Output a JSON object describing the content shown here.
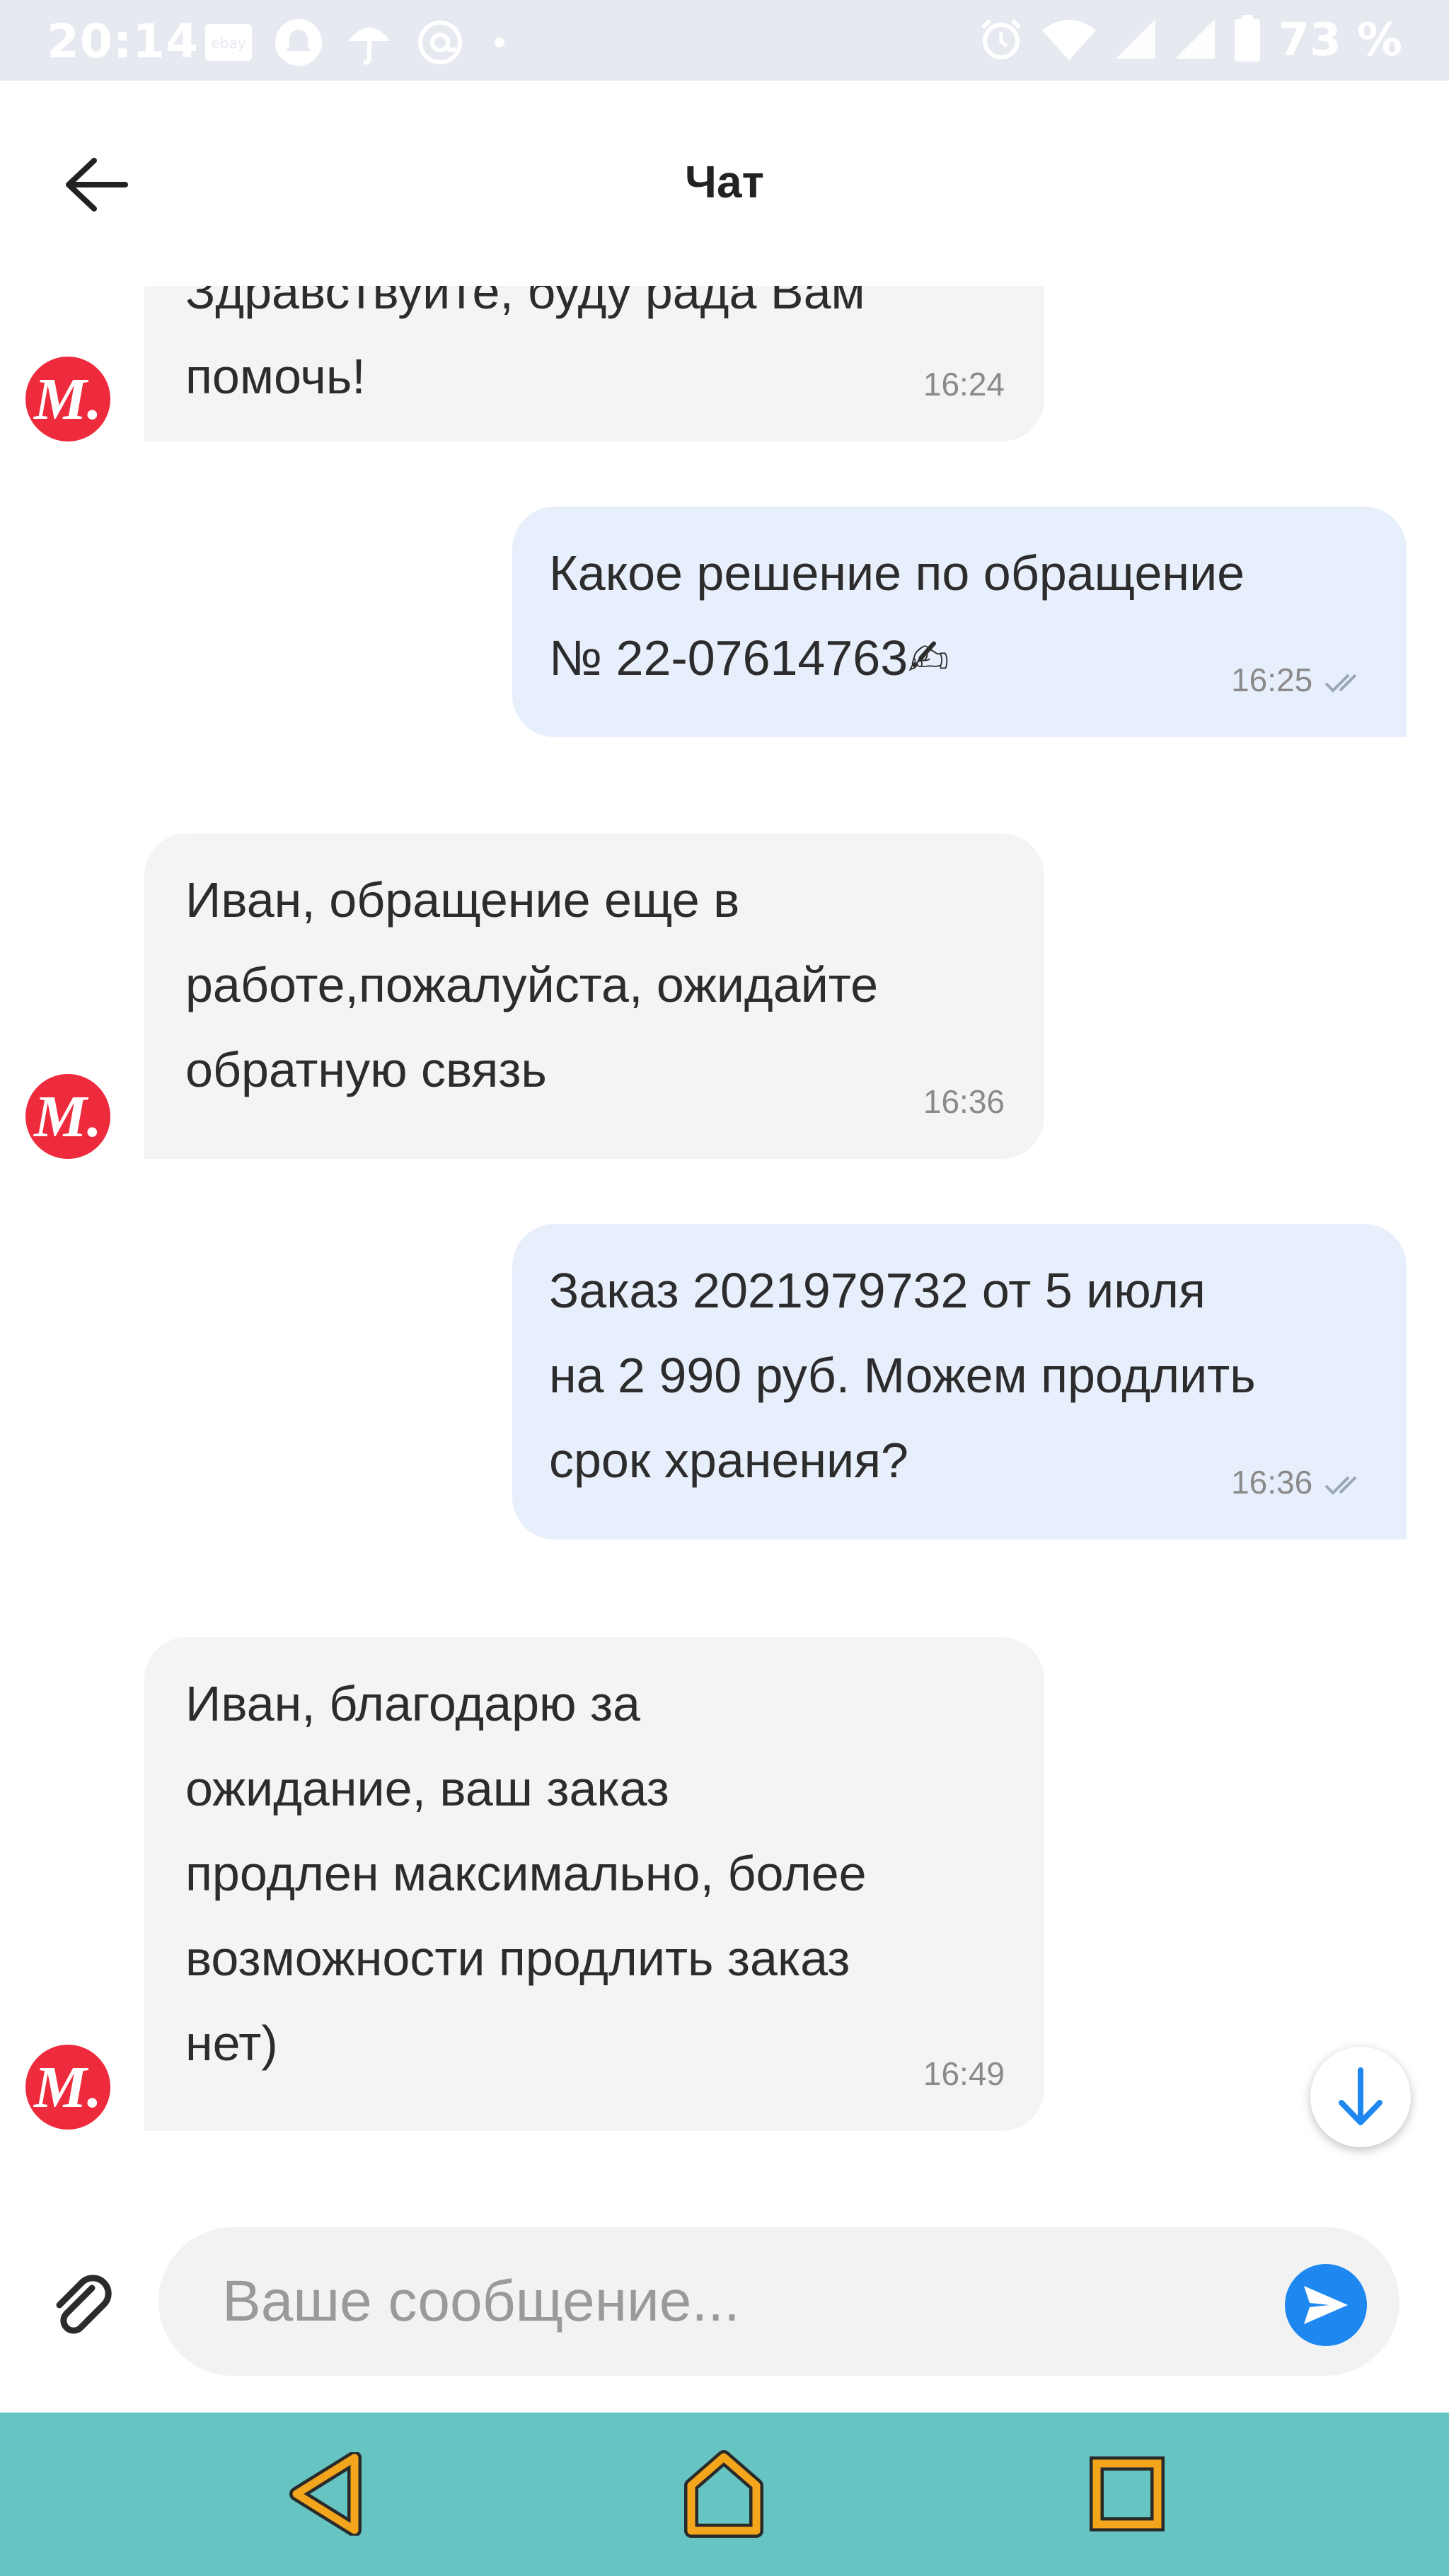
{
  "status_bar": {
    "time": "20:14",
    "battery": "73 %",
    "left_icons": [
      "ebay-icon",
      "notification-icon",
      "umbrella-icon",
      "at-icon",
      "dot-icon"
    ],
    "right_icons": [
      "alarm-icon",
      "wifi-icon",
      "signal-icon",
      "signal-icon",
      "battery-icon"
    ]
  },
  "header": {
    "title": "Чат"
  },
  "avatar_letter": "М.",
  "messages": [
    {
      "direction": "in",
      "text": "Здравствуйте, буду рада Вам\nпомочь!",
      "time": "16:24"
    },
    {
      "direction": "out",
      "text": "Какое решение по обращение\n№ 22-07614763✍",
      "time": "16:25",
      "status": "read"
    },
    {
      "direction": "in",
      "text": "Иван, обращение еще в\nработе,пожалуйста, ожидайте\nобратную связь",
      "time": "16:36"
    },
    {
      "direction": "out",
      "text": "Заказ 2021979732 от 5 июля\nна 2 990 руб. Можем продлить\nсрок хранения?",
      "time": "16:36",
      "status": "read"
    },
    {
      "direction": "in",
      "text": "Иван, благодарю за\nожидание, ваш заказ\nпродлен максимально, более\nвозможности продлить заказ\nнет)",
      "time": "16:49"
    }
  ],
  "composer": {
    "placeholder": "Ваше сообщение...",
    "value": ""
  },
  "colors": {
    "avatar": "#ee2a3d",
    "incoming_bubble": "#f4f4f4",
    "outgoing_bubble": "#e8effc",
    "send_button": "#1e88f0",
    "nav_bar": "#66c4c2",
    "nav_icons": "#f3a51c"
  }
}
